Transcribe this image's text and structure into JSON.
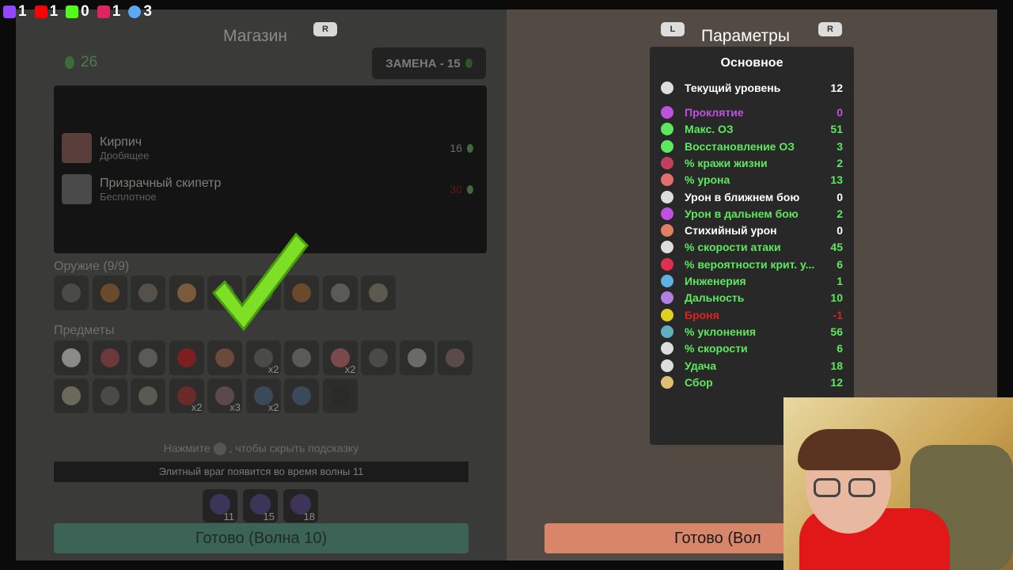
{
  "overlay": [
    {
      "name": "twitch",
      "value": "1",
      "color": "#9146ff"
    },
    {
      "name": "youtube",
      "value": "1",
      "color": "#ff0000"
    },
    {
      "name": "kick",
      "value": "0",
      "color": "#53fc18"
    },
    {
      "name": "live",
      "value": "1",
      "color": "#e0245e"
    },
    {
      "name": "viewers",
      "value": "3",
      "color": "#5aa9f5"
    }
  ],
  "shop": {
    "title": "Магазин",
    "title_key": "R",
    "coins": "26",
    "reroll_label": "ЗАМЕНА - 15",
    "tooltip_items": [
      {
        "name": "Кирпич",
        "type": "Дробящее",
        "price": "16"
      },
      {
        "name": "Призрачный скипетр",
        "type": "Бесплотное",
        "price": "30"
      }
    ],
    "weapons_label": "Оружие (9/9)",
    "items_label": "Предметы",
    "hint_pre": "Нажмите",
    "hint_post": ", чтобы скрыть подсказку",
    "elite_text": "Элитный враг появится во время волны 11",
    "elite_waves": [
      "11",
      "15",
      "18"
    ],
    "ready_label": "Готово (Волна 10)"
  },
  "weapons": [
    "",
    "",
    "",
    "",
    "",
    "",
    "",
    "",
    ""
  ],
  "items_row1": [
    "",
    "",
    "",
    "",
    "",
    "x2",
    "",
    "x2",
    "",
    "",
    ""
  ],
  "items_row2": [
    "",
    "",
    "",
    "x2",
    "x3",
    "x2",
    "",
    ""
  ],
  "params": {
    "title": "Параметры",
    "key_left": "L",
    "key_right": "R",
    "section": "Основное",
    "level": {
      "name": "Текущий уровень",
      "value": "12",
      "color": "#ffffff"
    },
    "stats": [
      {
        "name": "Проклятие",
        "value": "0",
        "color": "#c050e0"
      },
      {
        "name": "Макс. ОЗ",
        "value": "51",
        "color": "#5ee85e"
      },
      {
        "name": "Восстановление ОЗ",
        "value": "3",
        "color": "#5ee85e"
      },
      {
        "name": "% кражи жизни",
        "value": "2",
        "color": "#5ee85e"
      },
      {
        "name": "% урона",
        "value": "13",
        "color": "#5ee85e"
      },
      {
        "name": "Урон в ближнем бою",
        "value": "0",
        "color": "#ffffff"
      },
      {
        "name": "Урон в дальнем бою",
        "value": "2",
        "color": "#5ee85e"
      },
      {
        "name": "Стихийный урон",
        "value": "0",
        "color": "#ffffff"
      },
      {
        "name": "% скорости атаки",
        "value": "45",
        "color": "#5ee85e"
      },
      {
        "name": "% вероятности крит. у...",
        "value": "6",
        "color": "#5ee85e"
      },
      {
        "name": "Инженерия",
        "value": "1",
        "color": "#5ee85e"
      },
      {
        "name": "Дальность",
        "value": "10",
        "color": "#5ee85e"
      },
      {
        "name": "Броня",
        "value": "-1",
        "color": "#e02020"
      },
      {
        "name": "% уклонения",
        "value": "56",
        "color": "#5ee85e"
      },
      {
        "name": "% скорости",
        "value": "6",
        "color": "#5ee85e"
      },
      {
        "name": "Удача",
        "value": "18",
        "color": "#5ee85e"
      },
      {
        "name": "Сбор",
        "value": "12",
        "color": "#5ee85e"
      }
    ],
    "ready_label": "Готово (Вол"
  }
}
